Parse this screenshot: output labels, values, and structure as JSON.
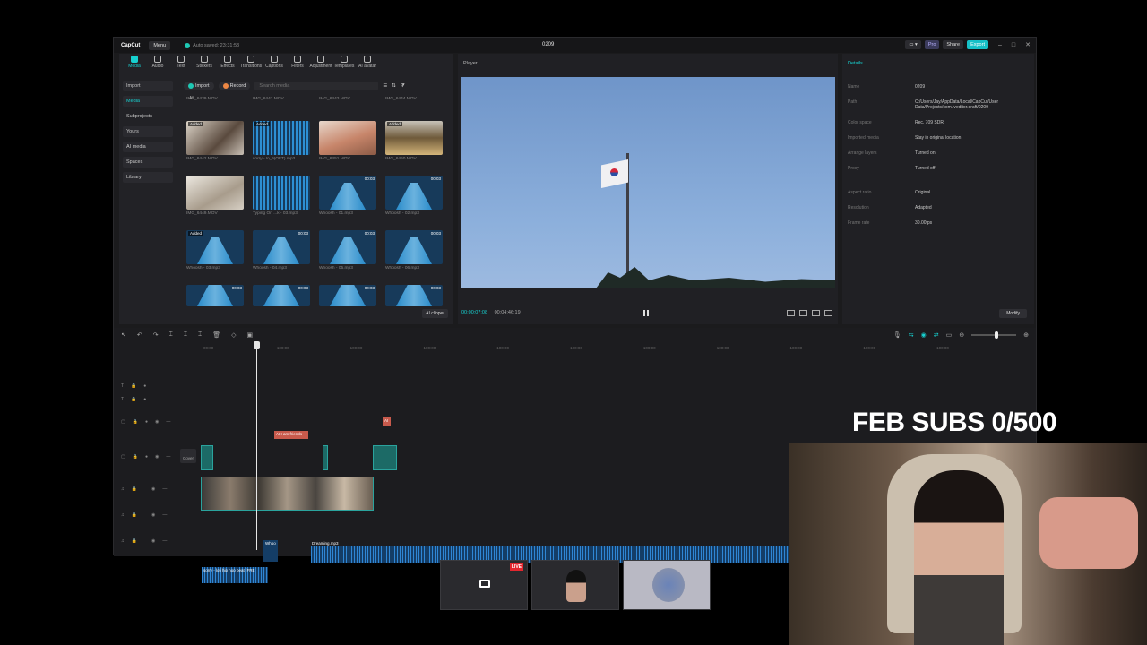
{
  "app": {
    "logo": "CapCut",
    "menu_label": "Menu",
    "autosave": "Auto saved: 23:31:53",
    "project_title": "0209",
    "pro_label": "Pro",
    "share_label": "Share",
    "export_label": "Export"
  },
  "toolbar": {
    "items": [
      "Media",
      "Audio",
      "Text",
      "Stickers",
      "Effects",
      "Transitions",
      "Captions",
      "Filters",
      "Adjustment",
      "Templates",
      "AI avatar"
    ]
  },
  "sidebar": {
    "items": [
      "Import",
      "Media",
      "Subprojects",
      "Yours",
      "AI media",
      "Spaces",
      "Library"
    ]
  },
  "media": {
    "import_label": "Import",
    "record_label": "Record",
    "search_placeholder": "Search media",
    "all_label": "All",
    "row0_captions": [
      "IMG_6439.MOV",
      "IMG_6441.MOV",
      "IMG_6443.MOV",
      "IMG_6444.MOV"
    ],
    "items": [
      {
        "caption": "IMG_6442.MOV",
        "badge": "Added",
        "dur": ""
      },
      {
        "caption": "sorry - lo_fi(OFT).mp3",
        "badge": "Added",
        "dur": ""
      },
      {
        "caption": "IMG_6451.MOV",
        "badge": "",
        "dur": ""
      },
      {
        "caption": "IMG_6450.MOV",
        "badge": "Added",
        "dur": ""
      },
      {
        "caption": "IMG_6449.MOV",
        "badge": "",
        "dur": ""
      },
      {
        "caption": "Typing On ...k - 03.mp3",
        "badge": "",
        "dur": ""
      },
      {
        "caption": "Whoosh - 01.mp3",
        "badge": "",
        "dur": "00:03"
      },
      {
        "caption": "Whoosh - 02.mp3",
        "badge": "",
        "dur": "00:03"
      },
      {
        "caption": "Whoosh - 03.mp3",
        "badge": "Added",
        "dur": ""
      },
      {
        "caption": "Whoosh - 04.mp3",
        "badge": "",
        "dur": "00:03"
      },
      {
        "caption": "Whoosh - 05.mp3",
        "badge": "",
        "dur": "00:03"
      },
      {
        "caption": "Whoosh - 06.mp3",
        "badge": "",
        "dur": "00:03"
      },
      {
        "caption": "",
        "badge": "",
        "dur": "00:03"
      },
      {
        "caption": "",
        "badge": "",
        "dur": "00:03"
      },
      {
        "caption": "",
        "badge": "",
        "dur": "00:03"
      },
      {
        "caption": "",
        "badge": "",
        "dur": "00:03"
      }
    ],
    "ai_clipper": "AI clipper"
  },
  "player": {
    "title": "Player",
    "current_time": "00:00:07:08",
    "total_time": "00:04:46:19"
  },
  "details": {
    "title": "Details",
    "rows": [
      {
        "k": "Name",
        "v": "0209"
      },
      {
        "k": "Path",
        "v": "C:/Users/Jay/AppData/Local/CapCut/User Data/Projects/com.lveditor.draft/0209"
      },
      {
        "k": "Color space",
        "v": "Rec. 709 SDR"
      },
      {
        "k": "Imported media",
        "v": "Stay in original location"
      },
      {
        "k": "Arrange layers",
        "v": "Turned on"
      },
      {
        "k": "Proxy",
        "v": "Turned off"
      },
      {
        "k": "Aspect ratio",
        "v": "Original"
      },
      {
        "k": "Resolution",
        "v": "Adapted"
      },
      {
        "k": "Frame rate",
        "v": "30.00fps"
      }
    ],
    "modify_label": "Modify"
  },
  "timeline": {
    "ruler": [
      "00:00",
      "100:00",
      "100:00",
      "100:00",
      "100:00",
      "100:00",
      "100:00",
      "100:00",
      "100:00",
      "100:00",
      "100:00"
    ],
    "text_clip": "AI I am friends",
    "text_clip2": "AI",
    "cover_label": "Cover",
    "audio_clip1": "Whoo",
    "audio_clip2": "Dreaming.mp3",
    "audio_clip3": "sorry - lofi hip hop beat (FRE"
  },
  "overlay": {
    "subs_text": "FEB SUBS 0/500",
    "live_label": "LIVE"
  }
}
